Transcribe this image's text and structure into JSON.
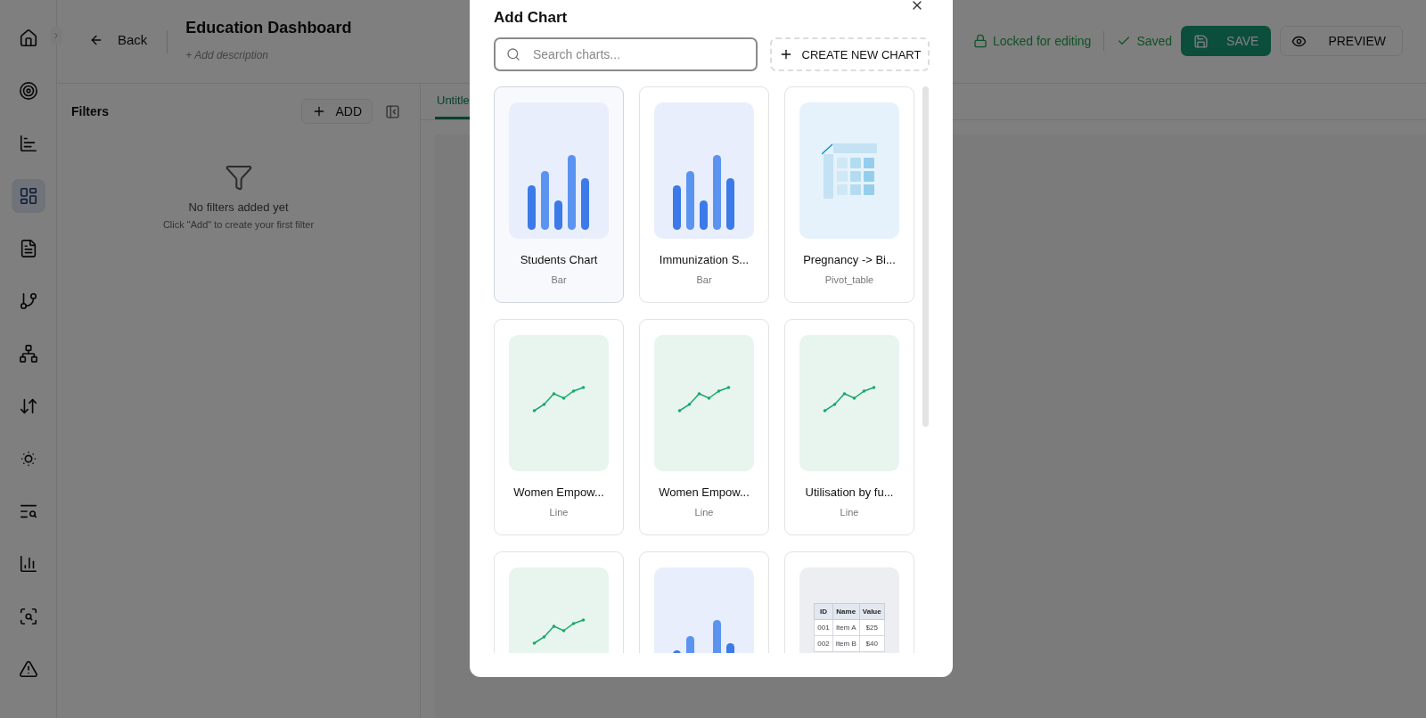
{
  "sidebar": {
    "items": [
      {
        "selected": false
      },
      {
        "selected": false
      },
      {
        "selected": false
      },
      {
        "selected": true
      },
      {
        "selected": false
      },
      {
        "selected": false
      },
      {
        "selected": false
      },
      {
        "selected": false
      },
      {
        "selected": false
      },
      {
        "selected": false
      },
      {
        "selected": false
      },
      {
        "selected": false
      },
      {
        "selected": false
      }
    ]
  },
  "header": {
    "back": "Back",
    "title": "Education Dashboard",
    "description_placeholder": "+ Add description",
    "lock_status": "Locked for editing",
    "save_status": "Saved",
    "save_button": "SAVE",
    "preview_button": "PREVIEW"
  },
  "filters": {
    "title": "Filters",
    "add_button": "ADD",
    "empty_title": "No filters added yet",
    "empty_hint": "Click \"Add\" to create your first filter"
  },
  "tabs": [
    {
      "label": "Untitle",
      "selected": true
    }
  ],
  "modal": {
    "title": "Add Chart",
    "search": {
      "placeholder": "Search charts..."
    },
    "create_button": "CREATE NEW CHART",
    "charts": [
      {
        "kind": "bar",
        "name": "Students Chart",
        "type": "Bar",
        "selected": true
      },
      {
        "kind": "bar",
        "name": "Immunization S...",
        "type": "Bar",
        "selected": false
      },
      {
        "kind": "pivot",
        "name": "Pregnancy -> Bi...",
        "type": "Pivot_table",
        "selected": false
      },
      {
        "kind": "line",
        "name": "Women Empow...",
        "type": "Line",
        "selected": false
      },
      {
        "kind": "line",
        "name": "Women Empow...",
        "type": "Line",
        "selected": false
      },
      {
        "kind": "line",
        "name": "Utilisation by fu...",
        "type": "Line",
        "selected": false
      },
      {
        "kind": "line",
        "selected": false
      },
      {
        "kind": "bar",
        "selected": false
      },
      {
        "kind": "table",
        "selected": false,
        "table": {
          "columns": [
            "ID",
            "Name",
            "Value"
          ],
          "rows": [
            [
              "001",
              "Item A",
              "$25"
            ],
            [
              "002",
              "Item B",
              "$40"
            ]
          ]
        }
      }
    ]
  }
}
